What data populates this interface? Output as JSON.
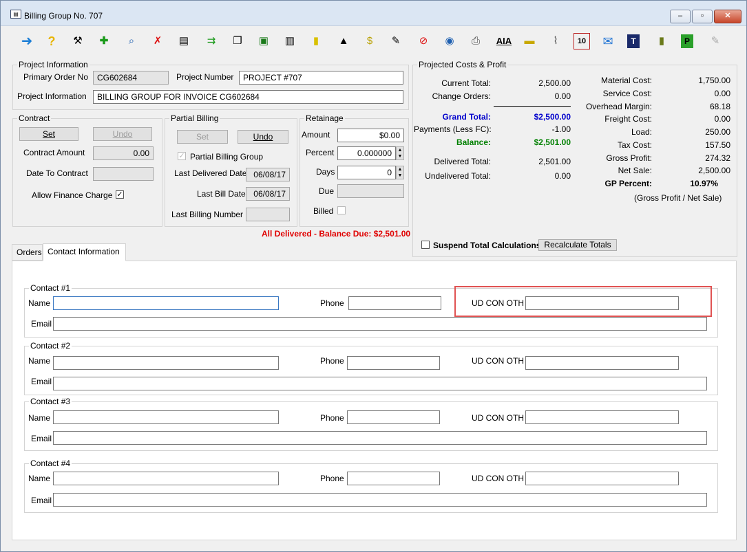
{
  "window": {
    "title": "Billing Group No. 707"
  },
  "toolbar": {
    "icons": [
      "back-arrow-icon",
      "help-icon",
      "wrench-icon",
      "new-icon",
      "search-icon",
      "delete-icon",
      "ledger-icon",
      "add-item-icon",
      "copy-icon",
      "money-icon",
      "document-icon",
      "note-icon",
      "up-arrow-icon",
      "folder-dollar-icon",
      "report-icon",
      "block-icon",
      "preview-icon",
      "print-icon",
      "aia-icon",
      "ticket-icon",
      "paperclip-icon",
      "calendar-icon",
      "mail-icon",
      "t-icon",
      "book-icon",
      "p-icon",
      "pencil-icon"
    ],
    "aia_label": "AIA",
    "calendar_label": "10",
    "t_label": "T",
    "p_label": "P"
  },
  "project_information": {
    "group_title": "Project Information",
    "primary_order_label": "Primary Order No",
    "primary_order_value": "CG602684",
    "project_number_label": "Project Number",
    "project_number_value": "PROJECT #707",
    "project_info_label": "Project Information",
    "project_info_value": "BILLING GROUP FOR INVOICE CG602684"
  },
  "contract": {
    "group_title": "Contract",
    "set_label": "Set",
    "undo_label": "Undo",
    "amount_label": "Contract Amount",
    "amount_value": "0.00",
    "date_label": "Date To Contract",
    "date_value": "",
    "finance_label": "Allow Finance Charge",
    "finance_checked": "✓"
  },
  "partial_billing": {
    "group_title": "Partial Billing",
    "set_label": "Set",
    "undo_label": "Undo",
    "group_check_label": "Partial Billing Group",
    "group_checked": "✓",
    "last_delivered_label": "Last Delivered Date",
    "last_delivered_value": "06/08/17",
    "last_bill_label": "Last Bill Date",
    "last_bill_value": "06/08/17",
    "last_number_label": "Last Billing Number",
    "last_number_value": ""
  },
  "retainage": {
    "group_title": "Retainage",
    "amount_label": "Amount",
    "amount_value": "$0.00",
    "percent_label": "Percent",
    "percent_value": "0.000000",
    "days_label": "Days",
    "days_value": "0",
    "due_label": "Due",
    "due_value": "",
    "billed_label": "Billed"
  },
  "status_message": "All Delivered - Balance Due: $2,501.00",
  "projected": {
    "group_title": "Projected Costs & Profit",
    "left": [
      {
        "label": "Current Total:",
        "value": "2,500.00",
        "style": "normal"
      },
      {
        "label": "Change Orders:",
        "value": "0.00",
        "style": "normal"
      },
      {
        "label": "Grand Total:",
        "value": "$2,500.00",
        "style": "blue"
      },
      {
        "label": "Payments (Less FC):",
        "value": "-1.00",
        "style": "normal"
      },
      {
        "label": "Balance:",
        "value": "$2,501.00",
        "style": "green"
      },
      {
        "label": "Delivered Total:",
        "value": "2,501.00",
        "style": "normal"
      },
      {
        "label": "Undelivered Total:",
        "value": "0.00",
        "style": "normal"
      }
    ],
    "right": [
      {
        "label": "Material Cost:",
        "value": "1,750.00"
      },
      {
        "label": "Service Cost:",
        "value": "0.00"
      },
      {
        "label": "Overhead Margin:",
        "value": "68.18"
      },
      {
        "label": "Freight Cost:",
        "value": "0.00"
      },
      {
        "label": "Load:",
        "value": "250.00"
      },
      {
        "label": "Tax Cost:",
        "value": "157.50"
      },
      {
        "label": "Gross Profit:",
        "value": "274.32"
      },
      {
        "label": "Net Sale:",
        "value": "2,500.00"
      },
      {
        "label": "GP Percent:",
        "value": "10.97%"
      }
    ],
    "gp_note": "(Gross Profit / Net Sale)",
    "suspend_label": "Suspend Total Calculations",
    "recalc_label": "Recalculate Totals"
  },
  "tabs": [
    "Orders",
    "Contact Information"
  ],
  "contacts": [
    {
      "title": "Contact #1",
      "name_label": "Name",
      "phone_label": "Phone",
      "ud_label": "UD CON OTH",
      "email_label": "Email",
      "name": "",
      "phone": "",
      "ud": "",
      "email": ""
    },
    {
      "title": "Contact #2",
      "name_label": "Name",
      "phone_label": "Phone",
      "ud_label": "UD CON OTH",
      "email_label": "Email",
      "name": "",
      "phone": "",
      "ud": "",
      "email": ""
    },
    {
      "title": "Contact #3",
      "name_label": "Name",
      "phone_label": "Phone",
      "ud_label": "UD CON OTH",
      "email_label": "Email",
      "name": "",
      "phone": "",
      "ud": "",
      "email": ""
    },
    {
      "title": "Contact #4",
      "name_label": "Name",
      "phone_label": "Phone",
      "ud_label": "UD CON OTH",
      "email_label": "Email",
      "name": "",
      "phone": "",
      "ud": "",
      "email": ""
    }
  ],
  "colors": {
    "red": "#e00000",
    "blue": "#0000cc",
    "green": "#008000",
    "highlight": "#e05252"
  }
}
